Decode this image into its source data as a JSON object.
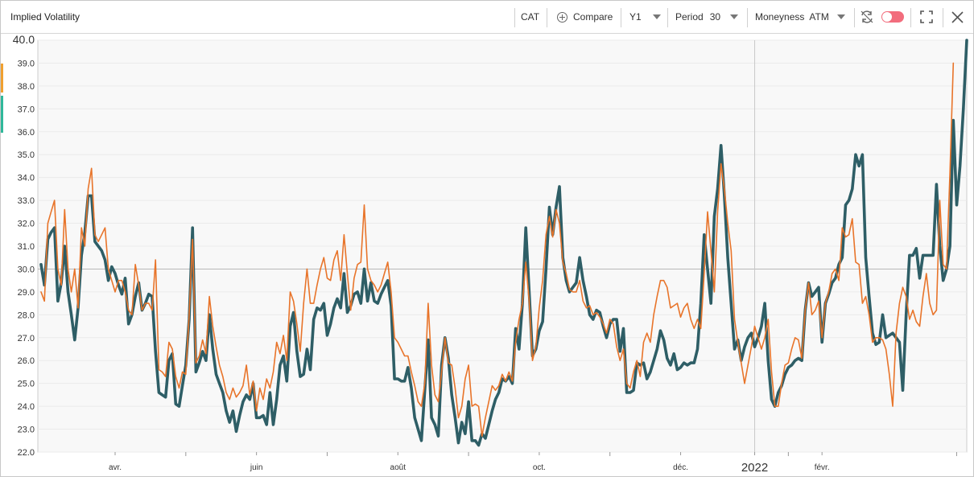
{
  "header": {
    "title": "Implied Volatility",
    "ticker": "CAT",
    "compare_label": "Compare",
    "range": "Y1",
    "period_label": "Period",
    "period_value": "30",
    "moneyness_label": "Moneyness",
    "moneyness_value": "ATM"
  },
  "icons": [
    "plus-circle-icon",
    "caret-down-icon",
    "refresh-icon",
    "toggle-switch",
    "fullscreen-icon",
    "close-icon"
  ],
  "colors": {
    "series_dark": "#2e5e66",
    "series_orange": "#e8742a",
    "toggle": "#f26d7d",
    "side_orange": "#f0a030",
    "side_teal": "#2fb89a"
  },
  "chart_data": {
    "type": "line",
    "title": "",
    "xlabel": "",
    "ylabel": "",
    "ylim": [
      22,
      40
    ],
    "grid": true,
    "y_ticks": [
      "22.0",
      "23.0",
      "24.0",
      "25.0",
      "26.0",
      "27.0",
      "28.0",
      "29.0",
      "30.0",
      "31.0",
      "32.0",
      "33.0",
      "34.0",
      "35.0",
      "36.0",
      "37.0",
      "38.0",
      "39.0",
      "40.0"
    ],
    "x_tick_labels": [
      {
        "label": "avr.",
        "index": 22
      },
      {
        "label": "juin",
        "index": 64
      },
      {
        "label": "août",
        "index": 106
      },
      {
        "label": "oct.",
        "index": 148
      },
      {
        "label": "déc.",
        "index": 190
      },
      {
        "label": "2022",
        "index": 212
      },
      {
        "label": "févr.",
        "index": 232
      }
    ],
    "series": [
      {
        "values": [
          30.2,
          29.3,
          31.3,
          31.6,
          31.8,
          28.6,
          29.4,
          31.0,
          29.0,
          28.0,
          26.9,
          28.3,
          30.6,
          31.6,
          33.2,
          33.2,
          31.2,
          31.0,
          30.8,
          30.4,
          29.5,
          30.1,
          29.8,
          29.3,
          28.9,
          29.6,
          27.6,
          28.0,
          28.8,
          29.4,
          28.2,
          28.5,
          28.9,
          28.8,
          26.4,
          24.6,
          24.5,
          24.4,
          26.0,
          26.3,
          24.1,
          24.0,
          24.9,
          25.8,
          27.8,
          31.8,
          25.5,
          25.9,
          26.4,
          26.0,
          28.0,
          26.5,
          25.4,
          25.0,
          24.6,
          23.8,
          23.3,
          23.8,
          22.9,
          23.6,
          24.2,
          24.5,
          24.3,
          25.0,
          23.5,
          23.5,
          23.6,
          23.2,
          24.6,
          23.2,
          24.3,
          25.8,
          26.2,
          25.1,
          27.5,
          28.1,
          26.4,
          25.3,
          25.4,
          26.5,
          25.6,
          27.8,
          28.3,
          28.2,
          28.5,
          27.1,
          27.6,
          28.3,
          28.7,
          28.3,
          29.8,
          28.1,
          28.4,
          28.9,
          29.0,
          28.5,
          30.0,
          28.6,
          29.4,
          28.6,
          28.5,
          28.9,
          29.2,
          29.5,
          28.4,
          25.2,
          25.2,
          25.1,
          25.1,
          25.7,
          24.8,
          23.5,
          23.0,
          22.5,
          24.7,
          26.9,
          23.5,
          23.2,
          22.7,
          25.8,
          27.0,
          26.1,
          24.5,
          23.5,
          22.4,
          23.3,
          22.8,
          24.2,
          22.5,
          22.5,
          22.3,
          22.8,
          22.6,
          23.2,
          23.8,
          24.3,
          24.6,
          25.2,
          25.1,
          25.3,
          25.0,
          27.4,
          26.5,
          28.5,
          31.8,
          29.0,
          26.2,
          26.5,
          27.3,
          27.7,
          30.0,
          32.7,
          31.5,
          32.7,
          33.6,
          30.5,
          29.5,
          29.0,
          29.2,
          29.4,
          30.5,
          29.5,
          28.8,
          28.0,
          27.8,
          28.2,
          28.1,
          27.5,
          27.0,
          27.6,
          27.8,
          27.8,
          26.4,
          27.4,
          24.6,
          24.6,
          24.7,
          25.9,
          25.8,
          25.9,
          25.2,
          25.5,
          26.0,
          26.5,
          27.3,
          26.9,
          26.1,
          25.8,
          26.3,
          25.6,
          25.7,
          25.9,
          25.8,
          25.9,
          25.9,
          26.5,
          28.5,
          31.5,
          30.0,
          28.5,
          32.3,
          33.5,
          35.4,
          33.2,
          30.5,
          28.5,
          26.5,
          26.9,
          26.0,
          26.6,
          27.0,
          27.2,
          26.6,
          27.0,
          27.5,
          28.5,
          26.0,
          24.3,
          24.0,
          24.6,
          24.9,
          25.4,
          25.7,
          25.8,
          26.0,
          26.1,
          26.0,
          28.2,
          29.4,
          28.8,
          29.0,
          29.2,
          26.8,
          28.5,
          28.9,
          29.4,
          29.6,
          30.2,
          30.5,
          32.8,
          33.0,
          33.5,
          35.0,
          34.5,
          35.0,
          30.5,
          28.8,
          27.2,
          26.7,
          26.8,
          28.0,
          27.0,
          27.1,
          27.2,
          27.0,
          26.8,
          24.7,
          28.0,
          30.6,
          30.6,
          30.9,
          29.6,
          30.6,
          30.6,
          30.6,
          30.6,
          33.7,
          31.0,
          29.5,
          30.0,
          31.0,
          36.5,
          32.8,
          34.5,
          37.0,
          40.0
        ]
      },
      {
        "values": [
          29.0,
          28.6,
          32.0,
          32.5,
          33.0,
          30.0,
          29.3,
          32.6,
          30.0,
          29.0,
          30.0,
          28.3,
          31.8,
          31.0,
          33.5,
          34.4,
          31.5,
          31.2,
          31.5,
          31.8,
          30.0,
          29.5,
          29.0,
          29.5,
          29.5,
          29.0,
          28.2,
          28.0,
          30.2,
          29.3,
          28.2,
          28.5,
          28.5,
          28.2,
          30.4,
          25.6,
          25.5,
          25.3,
          26.8,
          26.5,
          25.3,
          24.8,
          25.5,
          25.4,
          28.0,
          31.3,
          25.9,
          26.2,
          26.9,
          26.3,
          28.8,
          27.5,
          26.6,
          25.8,
          25.3,
          24.6,
          24.3,
          24.8,
          24.4,
          24.6,
          24.9,
          25.8,
          24.5,
          25.1,
          23.8,
          24.8,
          24.3,
          25.2,
          24.8,
          25.5,
          26.8,
          26.3,
          27.1,
          26.0,
          29.0,
          28.6,
          27.6,
          26.4,
          28.5,
          30.0,
          28.5,
          28.5,
          29.3,
          30.0,
          30.5,
          29.6,
          29.5,
          30.4,
          30.8,
          29.5,
          31.5,
          29.8,
          28.2,
          29.6,
          30.2,
          30.3,
          32.8,
          30.0,
          29.5,
          29.3,
          29.0,
          29.3,
          29.8,
          30.3,
          29.0,
          27.0,
          26.8,
          26.5,
          26.2,
          26.2,
          25.5,
          24.9,
          24.2,
          24.0,
          25.0,
          28.5,
          25.8,
          24.5,
          24.2,
          25.5,
          27.0,
          25.9,
          25.8,
          24.8,
          23.5,
          24.0,
          25.2,
          25.8,
          24.0,
          24.1,
          24.0,
          22.7,
          23.5,
          24.2,
          24.9,
          24.7,
          24.9,
          25.4,
          25.1,
          25.5,
          25.1,
          26.8,
          27.8,
          28.5,
          30.3,
          28.6,
          26.0,
          26.6,
          28.3,
          29.5,
          31.5,
          32.3,
          31.4,
          32.6,
          32.0,
          30.3,
          29.8,
          29.1,
          29.0,
          29.0,
          29.5,
          28.6,
          28.3,
          28.4,
          28.0,
          28.1,
          27.9,
          27.6,
          27.2,
          27.8,
          27.6,
          26.6,
          26.0,
          26.5,
          25.0,
          24.8,
          25.5,
          26.0,
          25.3,
          26.8,
          27.2,
          26.8,
          28.0,
          28.8,
          29.5,
          29.5,
          29.2,
          28.3,
          28.4,
          28.5,
          27.9,
          28.3,
          28.5,
          27.8,
          27.4,
          27.8,
          27.4,
          29.8,
          32.5,
          30.8,
          29.0,
          32.5,
          34.6,
          33.5,
          32.0,
          30.8,
          27.8,
          26.8,
          25.9,
          25.0,
          25.8,
          26.6,
          27.5,
          27.0,
          26.5,
          27.0,
          27.8,
          25.5,
          24.0,
          24.0,
          25.0,
          25.8,
          25.9,
          26.5,
          27.0,
          26.9,
          26.1,
          28.2,
          29.4,
          28.0,
          28.2,
          28.6,
          27.0,
          28.5,
          29.0,
          29.8,
          30.0,
          29.5,
          31.8,
          31.4,
          31.5,
          32.2,
          30.3,
          30.2,
          28.5,
          28.8,
          28.0,
          26.8,
          27.0,
          27.0,
          26.9,
          26.5,
          25.4,
          24.0,
          27.2,
          28.5,
          29.2,
          28.8,
          27.8,
          28.2,
          27.7,
          27.5,
          28.8,
          29.8,
          28.5,
          28.0,
          28.2,
          33.0,
          30.2,
          30.0,
          34.2,
          39.0
        ]
      }
    ]
  }
}
